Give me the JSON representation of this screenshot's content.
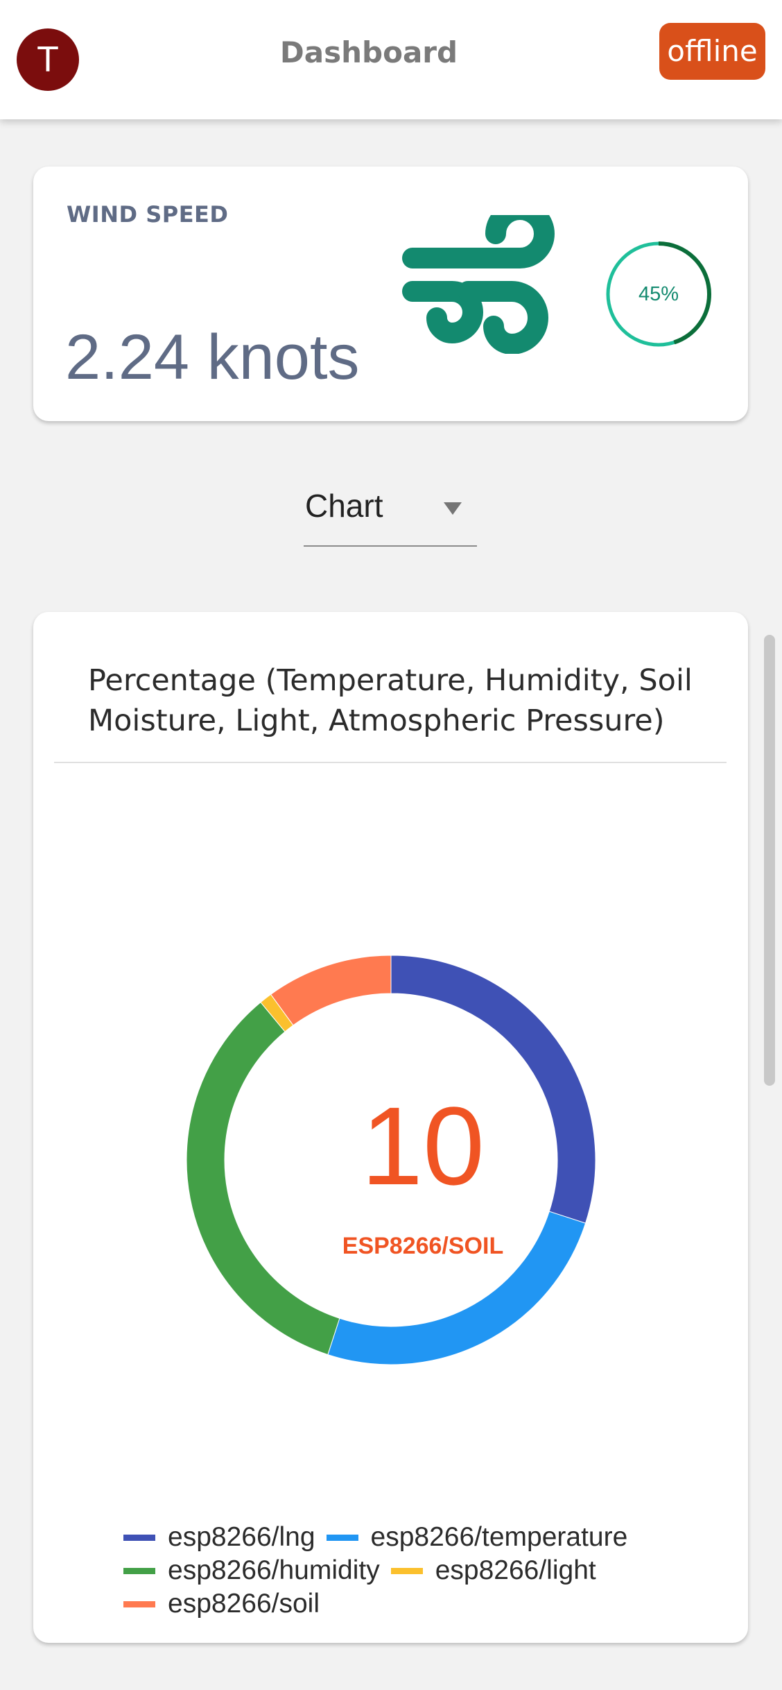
{
  "header": {
    "avatar_initial": "T",
    "title": "Dashboard",
    "status": "offline"
  },
  "wind": {
    "label": "WIND SPEED",
    "value": "2.24 knots",
    "progress_text": "45%",
    "progress_fraction": 0.45,
    "icon": "wind-icon",
    "color": "#138a6f"
  },
  "view_select": {
    "value": "Chart"
  },
  "chart_data": {
    "type": "pie",
    "title": "Percentage (Temperature, Humidity, Soil Moisture, Light, Atmospheric Pressure)",
    "center_value": "10",
    "center_label": "ESP8266/SOIL",
    "series": [
      {
        "name": "esp8266/lng",
        "value": 30,
        "color": "#3f51b5"
      },
      {
        "name": "esp8266/temperature",
        "value": 25,
        "color": "#2196f3"
      },
      {
        "name": "esp8266/humidity",
        "value": 34,
        "color": "#43a047"
      },
      {
        "name": "esp8266/light",
        "value": 1,
        "color": "#fbc02d"
      },
      {
        "name": "esp8266/soil",
        "value": 10,
        "color": "#ff7a50"
      }
    ],
    "legend": "bottom"
  },
  "colors": {
    "accent": "#d9501a",
    "avatar": "#7b0d0d",
    "muted_text": "#5f6b85"
  }
}
